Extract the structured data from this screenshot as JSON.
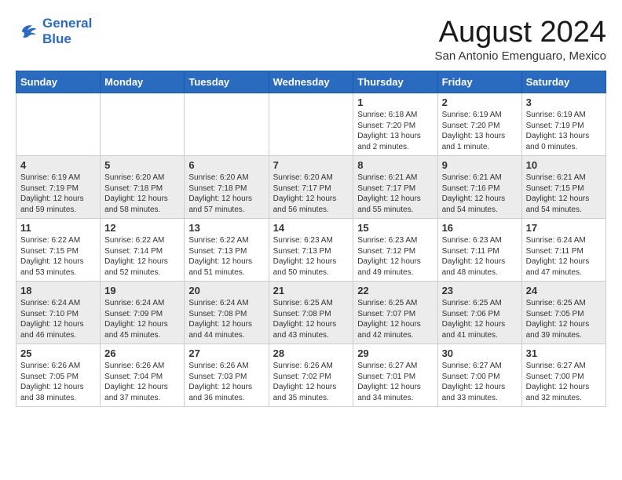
{
  "header": {
    "logo_line1": "General",
    "logo_line2": "Blue",
    "month_title": "August 2024",
    "location": "San Antonio Emenguaro, Mexico"
  },
  "days_of_week": [
    "Sunday",
    "Monday",
    "Tuesday",
    "Wednesday",
    "Thursday",
    "Friday",
    "Saturday"
  ],
  "weeks": [
    {
      "days": [
        {
          "num": "",
          "text": ""
        },
        {
          "num": "",
          "text": ""
        },
        {
          "num": "",
          "text": ""
        },
        {
          "num": "",
          "text": ""
        },
        {
          "num": "1",
          "text": "Sunrise: 6:18 AM\nSunset: 7:20 PM\nDaylight: 13 hours\nand 2 minutes."
        },
        {
          "num": "2",
          "text": "Sunrise: 6:19 AM\nSunset: 7:20 PM\nDaylight: 13 hours\nand 1 minute."
        },
        {
          "num": "3",
          "text": "Sunrise: 6:19 AM\nSunset: 7:19 PM\nDaylight: 13 hours\nand 0 minutes."
        }
      ]
    },
    {
      "days": [
        {
          "num": "4",
          "text": "Sunrise: 6:19 AM\nSunset: 7:19 PM\nDaylight: 12 hours\nand 59 minutes."
        },
        {
          "num": "5",
          "text": "Sunrise: 6:20 AM\nSunset: 7:18 PM\nDaylight: 12 hours\nand 58 minutes."
        },
        {
          "num": "6",
          "text": "Sunrise: 6:20 AM\nSunset: 7:18 PM\nDaylight: 12 hours\nand 57 minutes."
        },
        {
          "num": "7",
          "text": "Sunrise: 6:20 AM\nSunset: 7:17 PM\nDaylight: 12 hours\nand 56 minutes."
        },
        {
          "num": "8",
          "text": "Sunrise: 6:21 AM\nSunset: 7:17 PM\nDaylight: 12 hours\nand 55 minutes."
        },
        {
          "num": "9",
          "text": "Sunrise: 6:21 AM\nSunset: 7:16 PM\nDaylight: 12 hours\nand 54 minutes."
        },
        {
          "num": "10",
          "text": "Sunrise: 6:21 AM\nSunset: 7:15 PM\nDaylight: 12 hours\nand 54 minutes."
        }
      ]
    },
    {
      "days": [
        {
          "num": "11",
          "text": "Sunrise: 6:22 AM\nSunset: 7:15 PM\nDaylight: 12 hours\nand 53 minutes."
        },
        {
          "num": "12",
          "text": "Sunrise: 6:22 AM\nSunset: 7:14 PM\nDaylight: 12 hours\nand 52 minutes."
        },
        {
          "num": "13",
          "text": "Sunrise: 6:22 AM\nSunset: 7:13 PM\nDaylight: 12 hours\nand 51 minutes."
        },
        {
          "num": "14",
          "text": "Sunrise: 6:23 AM\nSunset: 7:13 PM\nDaylight: 12 hours\nand 50 minutes."
        },
        {
          "num": "15",
          "text": "Sunrise: 6:23 AM\nSunset: 7:12 PM\nDaylight: 12 hours\nand 49 minutes."
        },
        {
          "num": "16",
          "text": "Sunrise: 6:23 AM\nSunset: 7:11 PM\nDaylight: 12 hours\nand 48 minutes."
        },
        {
          "num": "17",
          "text": "Sunrise: 6:24 AM\nSunset: 7:11 PM\nDaylight: 12 hours\nand 47 minutes."
        }
      ]
    },
    {
      "days": [
        {
          "num": "18",
          "text": "Sunrise: 6:24 AM\nSunset: 7:10 PM\nDaylight: 12 hours\nand 46 minutes."
        },
        {
          "num": "19",
          "text": "Sunrise: 6:24 AM\nSunset: 7:09 PM\nDaylight: 12 hours\nand 45 minutes."
        },
        {
          "num": "20",
          "text": "Sunrise: 6:24 AM\nSunset: 7:08 PM\nDaylight: 12 hours\nand 44 minutes."
        },
        {
          "num": "21",
          "text": "Sunrise: 6:25 AM\nSunset: 7:08 PM\nDaylight: 12 hours\nand 43 minutes."
        },
        {
          "num": "22",
          "text": "Sunrise: 6:25 AM\nSunset: 7:07 PM\nDaylight: 12 hours\nand 42 minutes."
        },
        {
          "num": "23",
          "text": "Sunrise: 6:25 AM\nSunset: 7:06 PM\nDaylight: 12 hours\nand 41 minutes."
        },
        {
          "num": "24",
          "text": "Sunrise: 6:25 AM\nSunset: 7:05 PM\nDaylight: 12 hours\nand 39 minutes."
        }
      ]
    },
    {
      "days": [
        {
          "num": "25",
          "text": "Sunrise: 6:26 AM\nSunset: 7:05 PM\nDaylight: 12 hours\nand 38 minutes."
        },
        {
          "num": "26",
          "text": "Sunrise: 6:26 AM\nSunset: 7:04 PM\nDaylight: 12 hours\nand 37 minutes."
        },
        {
          "num": "27",
          "text": "Sunrise: 6:26 AM\nSunset: 7:03 PM\nDaylight: 12 hours\nand 36 minutes."
        },
        {
          "num": "28",
          "text": "Sunrise: 6:26 AM\nSunset: 7:02 PM\nDaylight: 12 hours\nand 35 minutes."
        },
        {
          "num": "29",
          "text": "Sunrise: 6:27 AM\nSunset: 7:01 PM\nDaylight: 12 hours\nand 34 minutes."
        },
        {
          "num": "30",
          "text": "Sunrise: 6:27 AM\nSunset: 7:00 PM\nDaylight: 12 hours\nand 33 minutes."
        },
        {
          "num": "31",
          "text": "Sunrise: 6:27 AM\nSunset: 7:00 PM\nDaylight: 12 hours\nand 32 minutes."
        }
      ]
    }
  ]
}
